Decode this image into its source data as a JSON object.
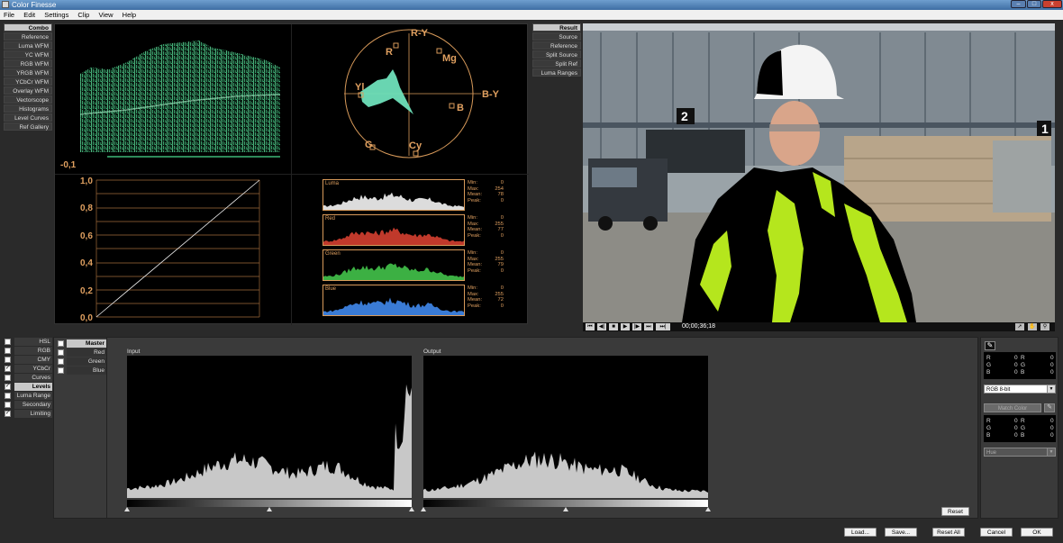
{
  "window": {
    "title": "Color Finesse",
    "min": "–",
    "max": "□",
    "close": "x"
  },
  "menu": [
    "File",
    "Edit",
    "Settings",
    "Clip",
    "View",
    "Help"
  ],
  "scope_buttons": [
    "Combo",
    "Reference",
    "Luma WFM",
    "YC WFM",
    "RGB WFM",
    "YRGB WFM",
    "YCbCr WFM",
    "Overlay WFM",
    "Vectorscope",
    "Histograms",
    "Level Curves",
    "Ref Gallery"
  ],
  "scope_selected": "Combo",
  "viewer_buttons": [
    "Result",
    "Source",
    "Reference",
    "Split Source",
    "Split Ref",
    "Luma Ranges"
  ],
  "viewer_selected": "Result",
  "waveform": {
    "min_label": "-0,1"
  },
  "vectorscope": {
    "labels": {
      "ry": "R-Y",
      "r": "R",
      "mg": "Mg",
      "yl": "Yl",
      "by": "B-Y",
      "b": "B",
      "g": "G",
      "cy": "Cy"
    }
  },
  "curve": {
    "ylabels": [
      "1,0",
      "0,8",
      "0,6",
      "0,4",
      "0,2",
      "0,0"
    ]
  },
  "histograms": [
    {
      "name": "Luma",
      "color": "#dcdcdc",
      "stats": [
        "Min:",
        "0",
        "Max:",
        "254",
        "Mean:",
        "78",
        "Peak:",
        "0"
      ]
    },
    {
      "name": "Red",
      "color": "#c0392b",
      "stats": [
        "Min:",
        "0",
        "Max:",
        "255",
        "Mean:",
        "77",
        "Peak:",
        "0"
      ]
    },
    {
      "name": "Green",
      "color": "#3cb043",
      "stats": [
        "Min:",
        "0",
        "Max:",
        "255",
        "Mean:",
        "79",
        "Peak:",
        "0"
      ]
    },
    {
      "name": "Blue",
      "color": "#3a7bd5",
      "stats": [
        "Min:",
        "0",
        "Max:",
        "255",
        "Mean:",
        "72",
        "Peak:",
        "0"
      ]
    }
  ],
  "playback": {
    "controls": [
      "⏮",
      "◀|",
      "■",
      "▶",
      "|▶",
      "⏭",
      "⏭|"
    ],
    "timecode": "00;00;36;18"
  },
  "viewer_signs": {
    "left": "2",
    "right": "1"
  },
  "correction_tabs": [
    {
      "label": "HSL",
      "checked": false,
      "selected": false
    },
    {
      "label": "RGB",
      "checked": false,
      "selected": false
    },
    {
      "label": "CMY",
      "checked": false,
      "selected": false
    },
    {
      "label": "YCbCr",
      "checked": true,
      "selected": false
    },
    {
      "label": "Curves",
      "checked": false,
      "selected": false
    },
    {
      "label": "Levels",
      "checked": true,
      "selected": true
    },
    {
      "label": "Luma Range",
      "checked": false,
      "selected": false
    },
    {
      "label": "Secondary",
      "checked": false,
      "selected": false
    },
    {
      "label": "Limiting",
      "checked": true,
      "selected": false
    }
  ],
  "channels": [
    {
      "label": "Master",
      "selected": true
    },
    {
      "label": "Red",
      "selected": false
    },
    {
      "label": "Green",
      "selected": false
    },
    {
      "label": "Blue",
      "selected": false
    }
  ],
  "levels": {
    "input_label": "Input",
    "output_label": "Output",
    "reset": "Reset"
  },
  "sampler": {
    "box1": [
      "R",
      "0",
      "R",
      "0",
      "G",
      "0",
      "G",
      "0",
      "B",
      "0",
      "B",
      "0"
    ],
    "mode": "RGB 8-bit",
    "match_color": "Match Color",
    "box2": [
      "R",
      "0",
      "R",
      "0",
      "G",
      "0",
      "G",
      "0",
      "B",
      "0",
      "B",
      "0"
    ],
    "hue": "Hue"
  },
  "buttons": {
    "load": "Load...",
    "save": "Save...",
    "reset_all": "Reset All",
    "cancel": "Cancel",
    "ok": "OK"
  }
}
